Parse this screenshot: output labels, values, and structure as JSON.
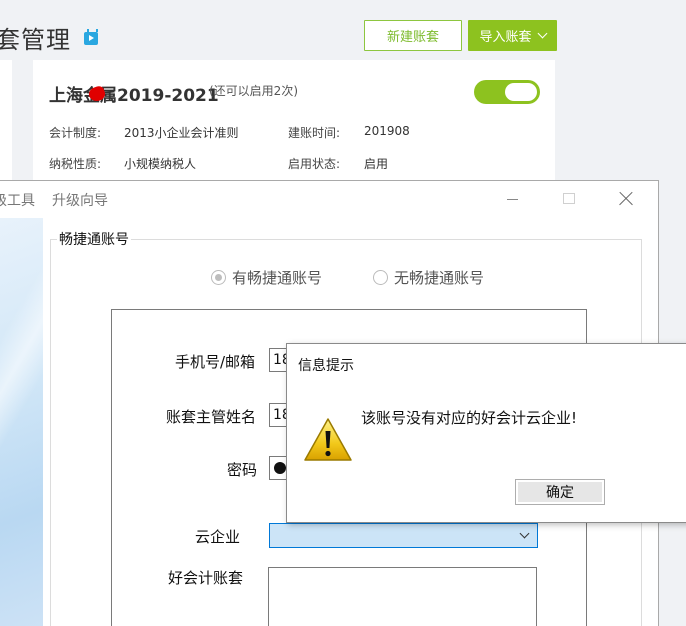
{
  "header": {
    "title": "套管理",
    "new_account_label": "新建账套",
    "import_account_label": "导入账套"
  },
  "account_card": {
    "title": "上海金属2019-2021",
    "subtitle": "(还可以启用2次)",
    "enabled": true,
    "fields": [
      {
        "label": "会计制度:",
        "value": "2013小企业会计准则"
      },
      {
        "label": "建账时间:",
        "value": "201908"
      },
      {
        "label": "纳税性质:",
        "value": "小规模纳税人"
      },
      {
        "label": "启用状态:",
        "value": "启用"
      }
    ]
  },
  "wizard": {
    "tabs": [
      "级工具",
      "升级向导"
    ],
    "group_label": "畅捷通账号",
    "radio_has": "有畅捷通账号",
    "radio_none": "无畅捷通账号",
    "selected_radio": "有畅捷通账号",
    "form": {
      "phone_label": "手机号/邮箱",
      "phone_value": "18",
      "manager_label": "账套主管姓名",
      "manager_value": "18",
      "password_label": "密码",
      "cloud_label": "云企业",
      "haokuaiji_label": "好会计账套"
    }
  },
  "dialog": {
    "title": "信息提示",
    "message": "该账号没有对应的好会计云企业!",
    "ok_label": "确定"
  },
  "colors": {
    "accent_green": "#8dc21f",
    "select_blue": "#cce4f7"
  }
}
